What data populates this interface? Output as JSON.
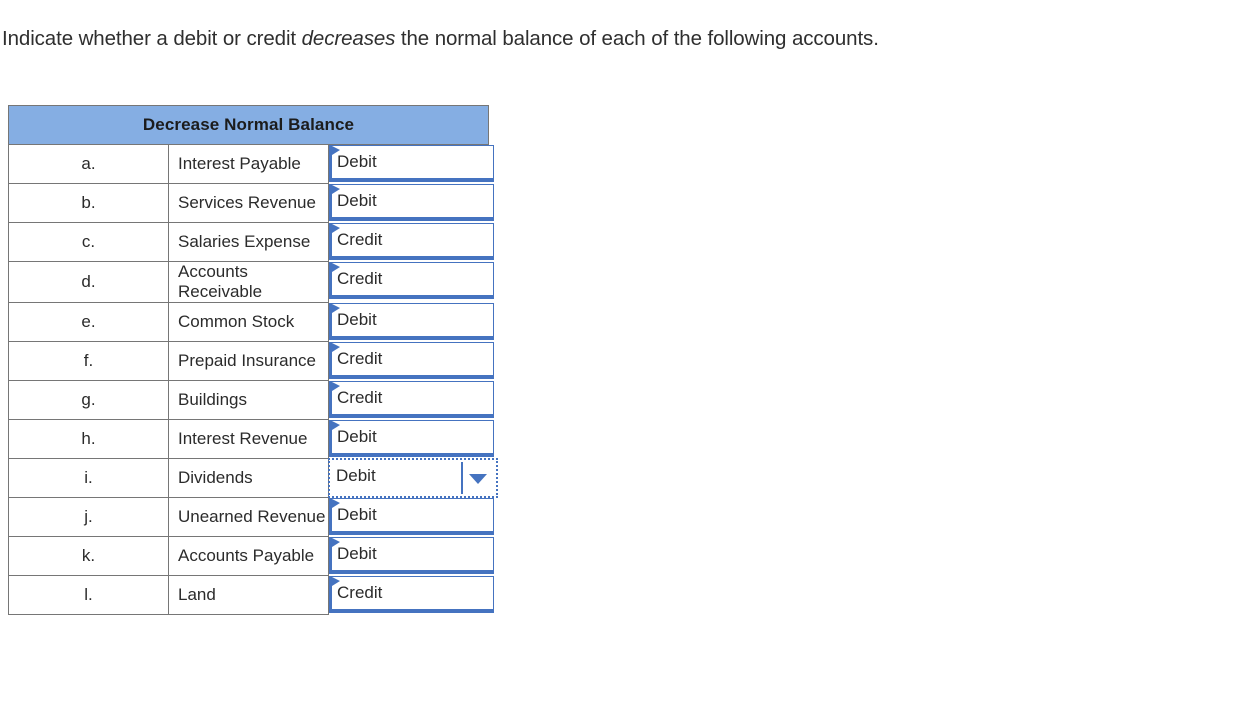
{
  "prompt": {
    "part1": "Indicate whether a debit or credit ",
    "emphasis": "decreases",
    "part2": " the normal balance of each of the following accounts."
  },
  "table": {
    "header": "Decrease Normal Balance",
    "rows": [
      {
        "key": "a.",
        "account": "Interest Payable",
        "answer": "Debit",
        "focused": false
      },
      {
        "key": "b.",
        "account": "Services Revenue",
        "answer": "Debit",
        "focused": false
      },
      {
        "key": "c.",
        "account": "Salaries Expense",
        "answer": "Credit",
        "focused": false
      },
      {
        "key": "d.",
        "account": "Accounts Receivable",
        "answer": "Credit",
        "focused": false
      },
      {
        "key": "e.",
        "account": "Common Stock",
        "answer": "Debit",
        "focused": false
      },
      {
        "key": "f.",
        "account": "Prepaid Insurance",
        "answer": "Credit",
        "focused": false
      },
      {
        "key": "g.",
        "account": "Buildings",
        "answer": "Credit",
        "focused": false
      },
      {
        "key": "h.",
        "account": "Interest Revenue",
        "answer": "Debit",
        "focused": false
      },
      {
        "key": "i.",
        "account": "Dividends",
        "answer": "Debit",
        "focused": true
      },
      {
        "key": "j.",
        "account": "Unearned Revenue",
        "answer": "Debit",
        "focused": false
      },
      {
        "key": "k.",
        "account": "Accounts Payable",
        "answer": "Debit",
        "focused": false
      },
      {
        "key": "l.",
        "account": "Land",
        "answer": "Credit",
        "focused": false
      }
    ]
  },
  "colors": {
    "header_fill": "#85AEE3",
    "select_border": "#4573C0",
    "grid_border": "#767676",
    "text": "#2b2b2b"
  },
  "icons": {
    "dropdown_caret": "caret-down-icon",
    "select_flag": "select-flag-icon"
  }
}
